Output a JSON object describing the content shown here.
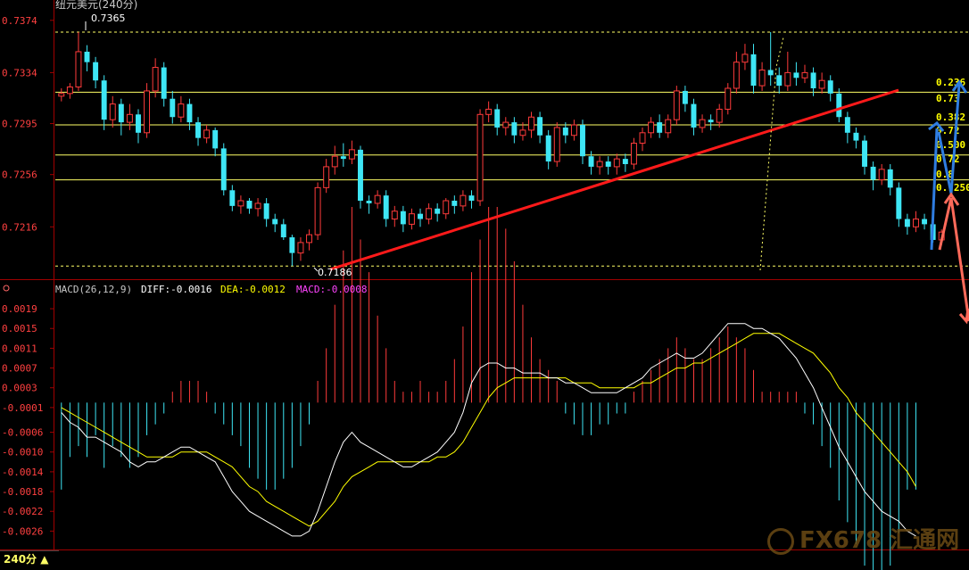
{
  "header": {
    "title": "纽元美元(240分)",
    "macd_label": "MACD(26,12,9)",
    "diff_label": "DIFF:-0.0016",
    "dea_label": "DEA:-0.0012",
    "macd_value_label": "MACD:-0.0008"
  },
  "footer": {
    "period": "240分 ▲"
  },
  "watermark": {
    "text": "FX678 汇通网"
  },
  "colors": {
    "up": "#ff3b3b",
    "down": "#3ee6f5",
    "grid": "#7a0000",
    "fib": "#ffff66",
    "trend": "#ff1a1a",
    "diff": "#ffffff",
    "dea": "#ffff00"
  },
  "chart_data": [
    {
      "type": "candlestick",
      "y_axis_ticks": [
        "0.7374",
        "0.7334",
        "0.7295",
        "0.7256",
        "0.7216"
      ],
      "ylim": [
        0.7178,
        0.738
      ],
      "annotations": {
        "high": "0.7365",
        "low": "0.7186"
      },
      "fib_labels": [
        "0.236",
        "0.73",
        "0.382",
        "0.72",
        "0.500",
        "0.72",
        "0.8",
        "0.7250"
      ],
      "fib_levels": [
        0.7319,
        0.7294,
        0.7271,
        0.7252
      ],
      "dashed_levels": [
        0.7365,
        0.7186
      ],
      "candles": [
        [
          0.7316,
          0.7318,
          0.7312,
          0.7322
        ],
        [
          0.7318,
          0.7323,
          0.7314,
          0.7326
        ],
        [
          0.7323,
          0.735,
          0.732,
          0.7365
        ],
        [
          0.735,
          0.7342,
          0.7335,
          0.7355
        ],
        [
          0.7342,
          0.7328,
          0.7322,
          0.7346
        ],
        [
          0.7328,
          0.7298,
          0.729,
          0.7332
        ],
        [
          0.7298,
          0.731,
          0.7292,
          0.7316
        ],
        [
          0.731,
          0.7296,
          0.7286,
          0.7314
        ],
        [
          0.7296,
          0.7302,
          0.729,
          0.731
        ],
        [
          0.7302,
          0.7288,
          0.728,
          0.7306
        ],
        [
          0.7288,
          0.732,
          0.7284,
          0.7326
        ],
        [
          0.732,
          0.7338,
          0.7315,
          0.7345
        ],
        [
          0.7338,
          0.7314,
          0.7308,
          0.7342
        ],
        [
          0.7314,
          0.73,
          0.7295,
          0.732
        ],
        [
          0.73,
          0.731,
          0.7296,
          0.7316
        ],
        [
          0.731,
          0.7296,
          0.729,
          0.7314
        ],
        [
          0.7296,
          0.7284,
          0.7278,
          0.73
        ],
        [
          0.7284,
          0.729,
          0.728,
          0.7294
        ],
        [
          0.729,
          0.7276,
          0.727,
          0.7292
        ],
        [
          0.7276,
          0.7244,
          0.724,
          0.728
        ],
        [
          0.7244,
          0.7232,
          0.7228,
          0.7248
        ],
        [
          0.7232,
          0.7236,
          0.7226,
          0.724
        ],
        [
          0.7236,
          0.723,
          0.7226,
          0.7238
        ],
        [
          0.723,
          0.7234,
          0.7224,
          0.7238
        ],
        [
          0.7234,
          0.7222,
          0.7216,
          0.7238
        ],
        [
          0.7222,
          0.7218,
          0.7212,
          0.7226
        ],
        [
          0.7218,
          0.7208,
          0.7206,
          0.7222
        ],
        [
          0.7208,
          0.7196,
          0.7186,
          0.721
        ],
        [
          0.7196,
          0.7204,
          0.719,
          0.7208
        ],
        [
          0.7204,
          0.721,
          0.7198,
          0.7214
        ],
        [
          0.721,
          0.7246,
          0.7206,
          0.725
        ],
        [
          0.7246,
          0.7262,
          0.7242,
          0.7268
        ],
        [
          0.7262,
          0.727,
          0.7256,
          0.7278
        ],
        [
          0.727,
          0.7268,
          0.7262,
          0.728
        ],
        [
          0.7268,
          0.7275,
          0.7264,
          0.7282
        ],
        [
          0.7275,
          0.7236,
          0.723,
          0.7278
        ],
        [
          0.7236,
          0.7234,
          0.7226,
          0.724
        ],
        [
          0.7234,
          0.724,
          0.723,
          0.7244
        ],
        [
          0.724,
          0.7222,
          0.7216,
          0.7244
        ],
        [
          0.7222,
          0.7228,
          0.7216,
          0.7232
        ],
        [
          0.7228,
          0.7218,
          0.7212,
          0.7232
        ],
        [
          0.7218,
          0.7226,
          0.7214,
          0.723
        ],
        [
          0.7226,
          0.7222,
          0.7216,
          0.723
        ],
        [
          0.7222,
          0.723,
          0.7218,
          0.7234
        ],
        [
          0.723,
          0.7226,
          0.722,
          0.7234
        ],
        [
          0.7226,
          0.7236,
          0.7222,
          0.7238
        ],
        [
          0.7236,
          0.7232,
          0.7226,
          0.724
        ],
        [
          0.7232,
          0.724,
          0.7228,
          0.7244
        ],
        [
          0.724,
          0.7236,
          0.723,
          0.7244
        ],
        [
          0.7236,
          0.7302,
          0.7232,
          0.7306
        ],
        [
          0.7302,
          0.7306,
          0.7296,
          0.7312
        ],
        [
          0.7306,
          0.7292,
          0.7286,
          0.731
        ],
        [
          0.7292,
          0.7296,
          0.7286,
          0.73
        ],
        [
          0.7296,
          0.7286,
          0.728,
          0.73
        ],
        [
          0.7286,
          0.729,
          0.7282,
          0.7296
        ],
        [
          0.729,
          0.73,
          0.7284,
          0.7304
        ],
        [
          0.73,
          0.7286,
          0.728,
          0.7304
        ],
        [
          0.7286,
          0.7266,
          0.726,
          0.729
        ],
        [
          0.7266,
          0.7292,
          0.7262,
          0.7296
        ],
        [
          0.7292,
          0.7286,
          0.728,
          0.7296
        ],
        [
          0.7286,
          0.7294,
          0.7282,
          0.7298
        ],
        [
          0.7294,
          0.727,
          0.7264,
          0.7298
        ],
        [
          0.727,
          0.7262,
          0.7256,
          0.7274
        ],
        [
          0.7262,
          0.7266,
          0.7256,
          0.727
        ],
        [
          0.7266,
          0.7262,
          0.7256,
          0.727
        ],
        [
          0.7262,
          0.7268,
          0.7256,
          0.7272
        ],
        [
          0.7268,
          0.7264,
          0.7258,
          0.7272
        ],
        [
          0.7264,
          0.728,
          0.726,
          0.7284
        ],
        [
          0.728,
          0.7288,
          0.7274,
          0.7292
        ],
        [
          0.7288,
          0.7296,
          0.7284,
          0.73
        ],
        [
          0.7296,
          0.7288,
          0.7284,
          0.7302
        ],
        [
          0.7288,
          0.7298,
          0.7284,
          0.7302
        ],
        [
          0.7298,
          0.732,
          0.7294,
          0.7324
        ],
        [
          0.732,
          0.731,
          0.7304,
          0.7324
        ],
        [
          0.731,
          0.7292,
          0.7286,
          0.7314
        ],
        [
          0.7292,
          0.7298,
          0.7288,
          0.7302
        ],
        [
          0.7298,
          0.7296,
          0.729,
          0.7302
        ],
        [
          0.7296,
          0.7306,
          0.7292,
          0.731
        ],
        [
          0.7306,
          0.7322,
          0.7302,
          0.7326
        ],
        [
          0.7322,
          0.7342,
          0.7318,
          0.735
        ],
        [
          0.7342,
          0.7348,
          0.7336,
          0.7356
        ],
        [
          0.7348,
          0.7324,
          0.7318,
          0.7356
        ],
        [
          0.7324,
          0.7336,
          0.732,
          0.7342
        ],
        [
          0.7336,
          0.7332,
          0.7324,
          0.7365
        ],
        [
          0.7332,
          0.7324,
          0.7318,
          0.7338
        ],
        [
          0.7324,
          0.7334,
          0.732,
          0.735
        ],
        [
          0.7334,
          0.733,
          0.7324,
          0.7342
        ],
        [
          0.733,
          0.7334,
          0.7326,
          0.734
        ],
        [
          0.7334,
          0.7322,
          0.7316,
          0.7338
        ],
        [
          0.7322,
          0.7328,
          0.7318,
          0.7334
        ],
        [
          0.7328,
          0.7318,
          0.7312,
          0.7332
        ],
        [
          0.7318,
          0.73,
          0.7296,
          0.7322
        ],
        [
          0.73,
          0.7288,
          0.728,
          0.7304
        ],
        [
          0.7288,
          0.7282,
          0.7276,
          0.7292
        ],
        [
          0.7282,
          0.7262,
          0.7256,
          0.7286
        ],
        [
          0.7262,
          0.7252,
          0.7244,
          0.7266
        ],
        [
          0.7252,
          0.726,
          0.7248,
          0.7264
        ],
        [
          0.726,
          0.7246,
          0.724,
          0.7264
        ],
        [
          0.7246,
          0.7222,
          0.7216,
          0.725
        ],
        [
          0.7222,
          0.7216,
          0.721,
          0.7226
        ],
        [
          0.7216,
          0.7222,
          0.7212,
          0.7228
        ],
        [
          0.7222,
          0.7218,
          0.7214,
          0.7226
        ],
        [
          0.7218,
          0.7206,
          0.7204,
          0.7222
        ],
        [
          0.7206,
          0.7212,
          0.7202,
          0.7214
        ]
      ]
    },
    {
      "type": "bar",
      "name_label": "MACD",
      "y_axis_ticks": [
        "0.0019",
        "0.0015",
        "0.0011",
        "0.0007",
        "0.0003",
        "-0.0001",
        "-0.0006",
        "-0.0010",
        "-0.0014",
        "-0.0018",
        "-0.0022",
        "-0.0026"
      ],
      "ylim": [
        -0.0029,
        0.0021
      ],
      "macd_bars": [
        -0.0008,
        -0.0005,
        -0.0004,
        -0.0005,
        -0.0003,
        -0.0006,
        -0.0004,
        -0.0005,
        -0.0006,
        -0.0005,
        -0.0003,
        -0.0002,
        -0.0001,
        0.0001,
        0.0002,
        0.0002,
        0.0002,
        0.0001,
        -0.0001,
        -0.0002,
        -0.0003,
        -0.0004,
        -0.0006,
        -0.0007,
        -0.0008,
        -0.0008,
        -0.0007,
        -0.0006,
        -0.0004,
        -0.0002,
        0.0002,
        0.0005,
        0.0009,
        0.0014,
        0.0018,
        0.0015,
        0.0012,
        0.0008,
        0.0005,
        0.0002,
        0.0001,
        0.0001,
        0.0002,
        0.0001,
        0.0001,
        0.0002,
        0.0004,
        0.0007,
        0.0012,
        0.0015,
        0.0018,
        0.0018,
        0.0016,
        0.0013,
        0.0009,
        0.0006,
        0.0004,
        0.0003,
        0.0002,
        -0.0001,
        -0.0002,
        -0.0003,
        -0.0003,
        -0.0002,
        -0.0002,
        -0.0001,
        -0.0001,
        0.0001,
        0.0002,
        0.0003,
        0.0004,
        0.0005,
        0.0006,
        0.0005,
        0.0004,
        0.0004,
        0.0005,
        0.0006,
        0.0007,
        0.0006,
        0.0005,
        0.0003,
        0.0001,
        0.0001,
        0.0001,
        0.0001,
        0.0001,
        -0.0001,
        -0.0002,
        -0.0004,
        -0.0006,
        -0.0009,
        -0.0011,
        -0.0013,
        -0.0015,
        -0.0016,
        -0.0016,
        -0.0015,
        -0.0012,
        -0.0008,
        -0.0008
      ],
      "diff": [
        -0.0002,
        -0.0004,
        -0.0005,
        -0.0007,
        -0.0007,
        -0.0008,
        -0.0009,
        -0.001,
        -0.0012,
        -0.0013,
        -0.0012,
        -0.0012,
        -0.0011,
        -0.001,
        -0.0009,
        -0.0009,
        -0.001,
        -0.0011,
        -0.0012,
        -0.0015,
        -0.0018,
        -0.002,
        -0.0022,
        -0.0023,
        -0.0024,
        -0.0025,
        -0.0026,
        -0.0027,
        -0.0027,
        -0.0026,
        -0.0022,
        -0.0017,
        -0.0012,
        -0.0008,
        -0.0006,
        -0.0008,
        -0.0009,
        -0.001,
        -0.0011,
        -0.0012,
        -0.0013,
        -0.0013,
        -0.0012,
        -0.0011,
        -0.001,
        -0.0008,
        -0.0006,
        -0.0002,
        0.0004,
        0.0007,
        0.0008,
        0.0008,
        0.0007,
        0.0007,
        0.0006,
        0.0006,
        0.0006,
        0.0005,
        0.0005,
        0.0004,
        0.0004,
        0.0003,
        0.0002,
        0.0002,
        0.0002,
        0.0002,
        0.0003,
        0.0004,
        0.0005,
        0.0007,
        0.0008,
        0.0009,
        0.001,
        0.0009,
        0.0009,
        0.001,
        0.0012,
        0.0014,
        0.0016,
        0.0016,
        0.0016,
        0.0015,
        0.0015,
        0.0014,
        0.0013,
        0.0011,
        0.0009,
        0.0006,
        0.0003,
        -0.0001,
        -0.0005,
        -0.0009,
        -0.0012,
        -0.0015,
        -0.0018,
        -0.002,
        -0.0022,
        -0.0023,
        -0.0024,
        -0.0026,
        -0.0027
      ],
      "dea": [
        -0.0001,
        -0.0002,
        -0.0003,
        -0.0004,
        -0.0005,
        -0.0006,
        -0.0007,
        -0.0008,
        -0.0009,
        -0.001,
        -0.0011,
        -0.0011,
        -0.0011,
        -0.0011,
        -0.001,
        -0.001,
        -0.001,
        -0.001,
        -0.0011,
        -0.0012,
        -0.0013,
        -0.0015,
        -0.0017,
        -0.0018,
        -0.002,
        -0.0021,
        -0.0022,
        -0.0023,
        -0.0024,
        -0.0025,
        -0.0024,
        -0.0022,
        -0.002,
        -0.0017,
        -0.0015,
        -0.0014,
        -0.0013,
        -0.0012,
        -0.0012,
        -0.0012,
        -0.0012,
        -0.0012,
        -0.0012,
        -0.0012,
        -0.0011,
        -0.0011,
        -0.001,
        -0.0008,
        -0.0005,
        -0.0002,
        0.0001,
        0.0003,
        0.0004,
        0.0005,
        0.0005,
        0.0005,
        0.0005,
        0.0005,
        0.0005,
        0.0005,
        0.0004,
        0.0004,
        0.0004,
        0.0003,
        0.0003,
        0.0003,
        0.0003,
        0.0003,
        0.0004,
        0.0004,
        0.0005,
        0.0006,
        0.0007,
        0.0007,
        0.0008,
        0.0008,
        0.0009,
        0.001,
        0.0011,
        0.0012,
        0.0013,
        0.0014,
        0.0014,
        0.0014,
        0.0014,
        0.0013,
        0.0012,
        0.0011,
        0.001,
        0.0008,
        0.0006,
        0.0003,
        0.0001,
        -0.0002,
        -0.0004,
        -0.0006,
        -0.0008,
        -0.001,
        -0.0012,
        -0.0014,
        -0.0017
      ]
    }
  ]
}
